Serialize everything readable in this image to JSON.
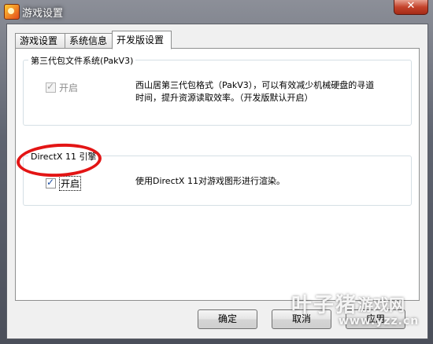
{
  "window": {
    "title": "游戏设置",
    "close_label": "✕"
  },
  "tabs": [
    {
      "label": "游戏设置"
    },
    {
      "label": "系统信息"
    },
    {
      "label": "开发版设置"
    }
  ],
  "groups": {
    "pak": {
      "title": "第三代包文件系统(PakV3)",
      "checkbox_label": "开启",
      "checked": true,
      "disabled": true,
      "description_line1": "西山居第三代包格式（PakV3），可以有效减少机械硬盘的寻道",
      "description_line2": "时间，提升资源读取效率。（开发版默认开启）"
    },
    "dx11": {
      "title": "DirectX 11 引擎",
      "checkbox_label": "开启",
      "checked": true,
      "description": "使用DirectX 11对游戏图形进行渲染。"
    }
  },
  "buttons": {
    "ok": "确定",
    "cancel": "取消",
    "apply": "应用"
  },
  "watermark": {
    "main": "叶子猪",
    "sub": "游戏网",
    "url": "www.yzz.cn"
  },
  "colors": {
    "annotation": "#e31515",
    "check": "#1d4fa3"
  }
}
